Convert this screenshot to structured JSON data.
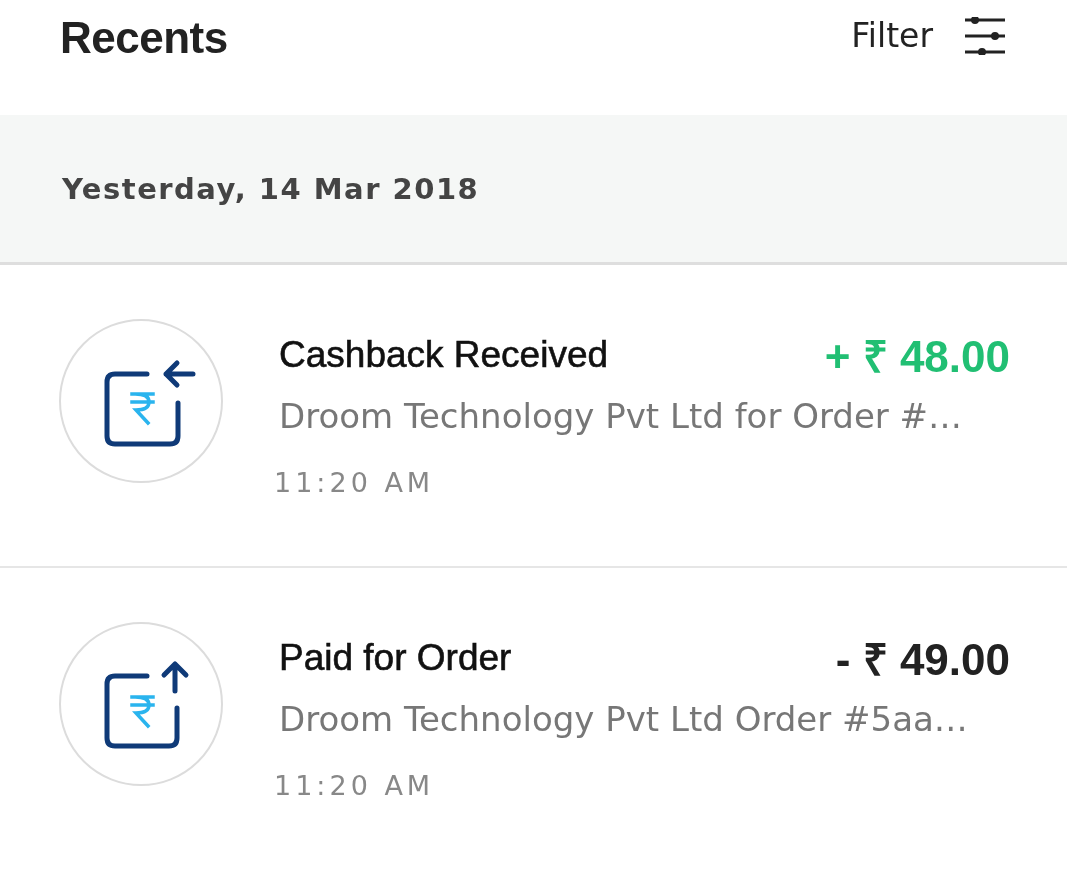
{
  "header": {
    "title": "Recents",
    "filter_label": "Filter"
  },
  "sections": [
    {
      "date": "Yesterday, 14 Mar 2018",
      "transactions": [
        {
          "kind": "credit",
          "title": "Cashback Received",
          "amount": "+ ₹ 48.00",
          "description": "Droom Technology Pvt Ltd for Order #…",
          "time": "11:20 AM"
        },
        {
          "kind": "debit",
          "title": "Paid for Order",
          "amount": "- ₹ 49.00",
          "description": "Droom Technology Pvt Ltd Order #5aa…",
          "time": "11:20 AM"
        }
      ]
    }
  ]
}
